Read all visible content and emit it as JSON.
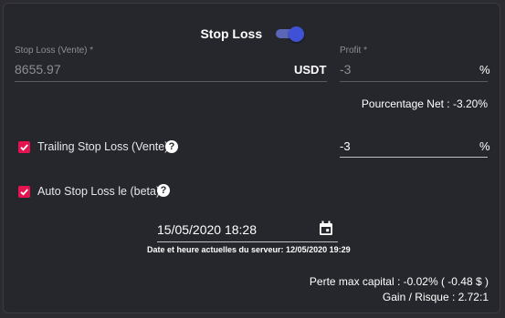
{
  "header": {
    "title": "Stop Loss",
    "toggle_on": true
  },
  "stop_loss_field": {
    "label": "Stop Loss (Vente) *",
    "value": "8655.97",
    "unit": "USDT"
  },
  "profit_field": {
    "label": "Profit *",
    "value": "-3",
    "unit": "%"
  },
  "net_percentage": "Pourcentage Net : -3.20%",
  "trailing": {
    "label": "Trailing Stop Loss (Vente)",
    "checked": true,
    "value": "-3",
    "unit": "%"
  },
  "auto_stop": {
    "label": "Auto Stop Loss le (beta)",
    "checked": true
  },
  "datetime": {
    "value": "15/05/2020 18:28",
    "server_time": "Date et heure actuelles du serveur: 12/05/2020 19:29"
  },
  "summary": {
    "perte_max": "Perte max capital : -0.02% ( -0.48 $ )",
    "gain_risque": "Gain / Risque : 2.72:1"
  },
  "colors": {
    "accent_checkbox": "#e5134f",
    "toggle": "#3f51d6",
    "background": "#26272d"
  },
  "icons": {
    "help": "?",
    "calendar": "calendar-icon"
  }
}
